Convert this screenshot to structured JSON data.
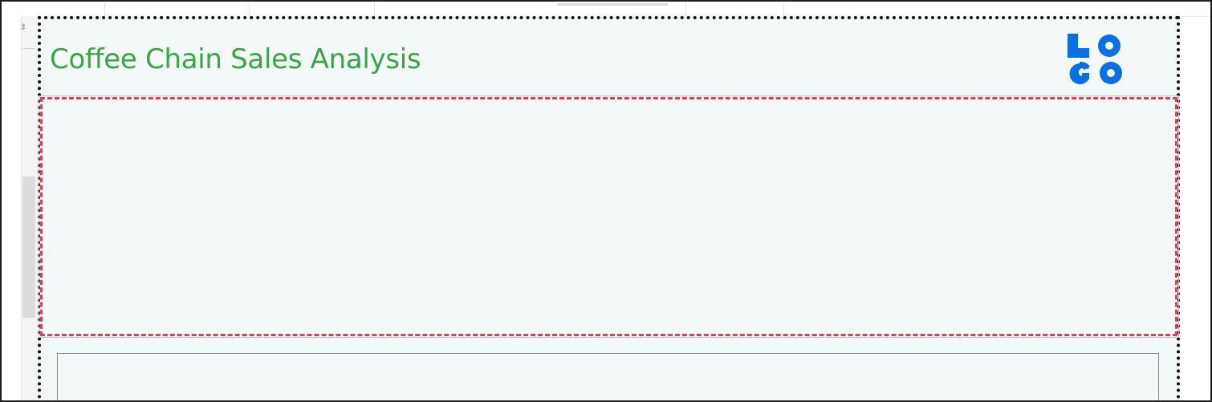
{
  "dashboard": {
    "title": "Coffee Chain Sales Analysis",
    "title_color": "#3aa544",
    "background_color": "#f3f9f9"
  },
  "logo": {
    "line1": "LO",
    "line2": "GO",
    "color": "#0a6fe0",
    "icon": "logo-mark"
  },
  "selection": {
    "border_color": "#e04158",
    "style": "dashed"
  },
  "container": {
    "border_color": "#111111",
    "style": "dotted"
  },
  "left_panel": {
    "resize_icon": "resize-vertical-icon"
  }
}
